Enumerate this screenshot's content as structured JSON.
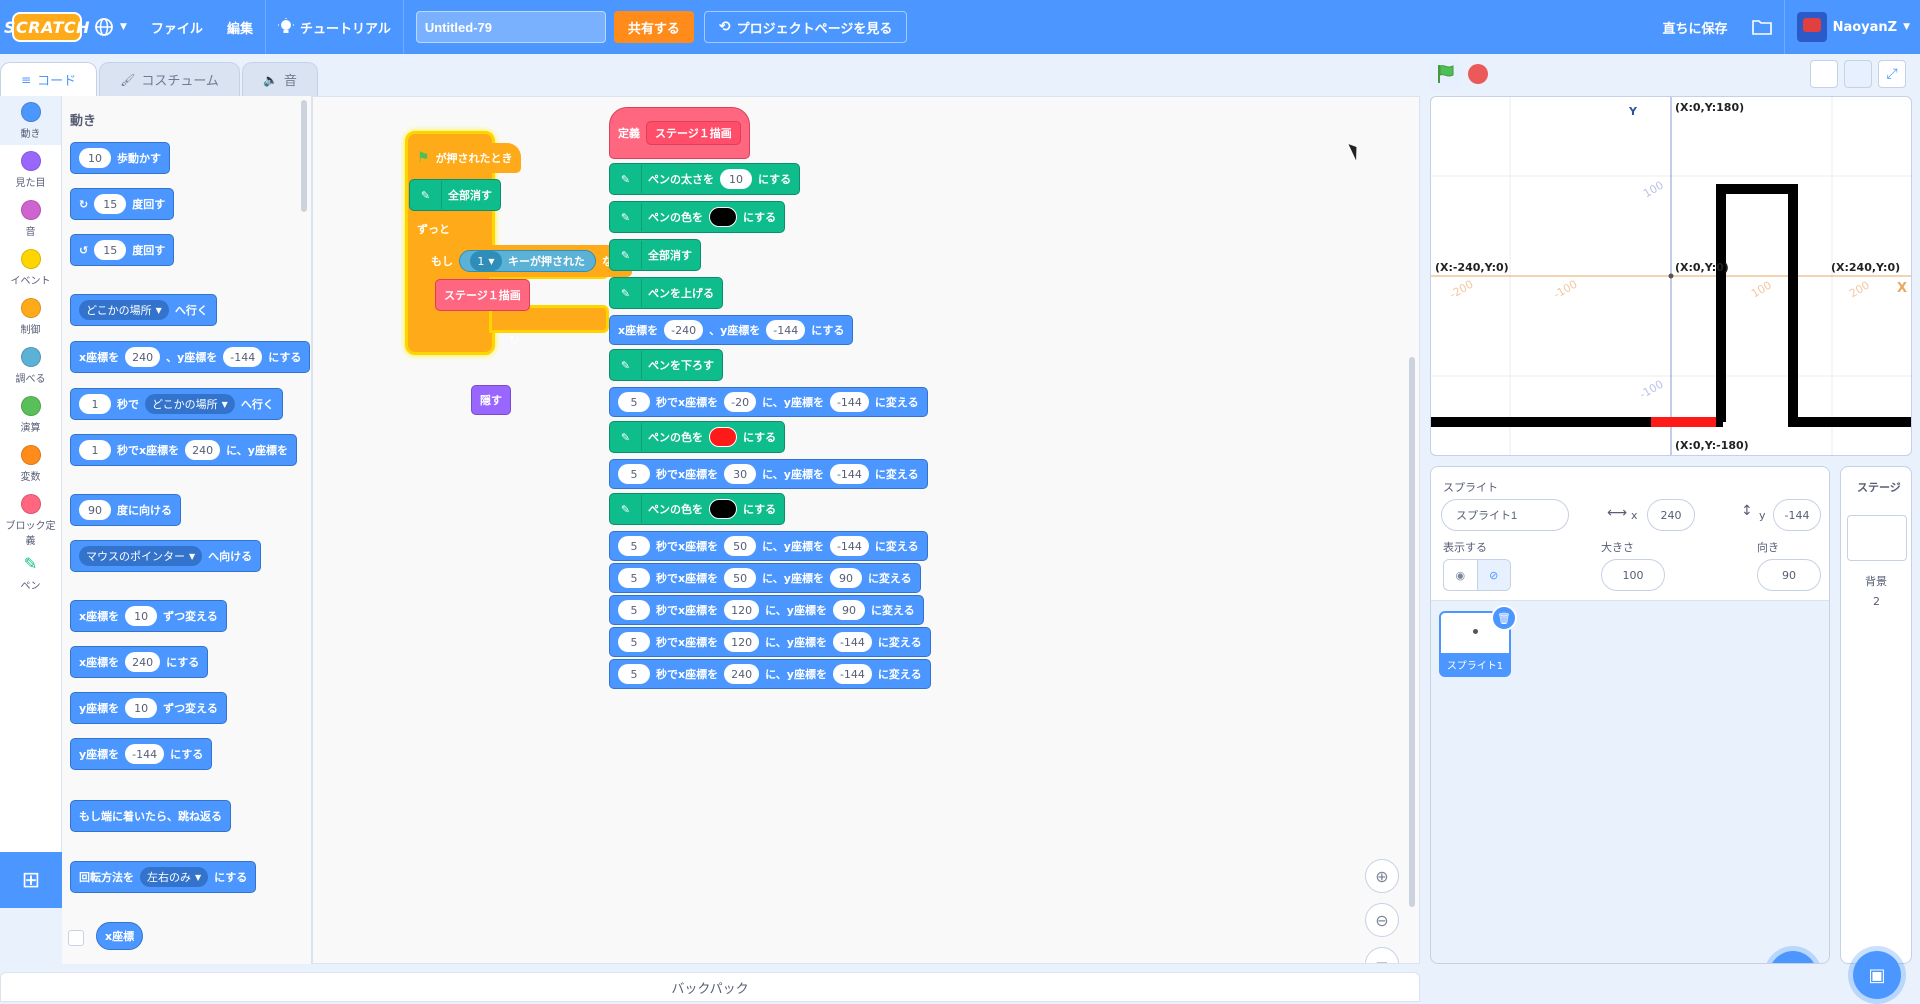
{
  "menubar": {
    "logo": "SCRATCH",
    "file": "ファイル",
    "edit": "編集",
    "tutorial": "チュートリアル",
    "project_title": "Untitled-79",
    "share": "共有する",
    "project_page": "プロジェクトページを見る",
    "save_now": "直ちに保存",
    "username": "NaoyanZ"
  },
  "tabs": {
    "code": "コード",
    "costume": "コスチューム",
    "sound": "音"
  },
  "categories": [
    {
      "label": "動き",
      "color": "#4c97ff"
    },
    {
      "label": "見た目",
      "color": "#9966ff"
    },
    {
      "label": "音",
      "color": "#cf63cf"
    },
    {
      "label": "イベント",
      "color": "#ffd500"
    },
    {
      "label": "制御",
      "color": "#ffab19"
    },
    {
      "label": "調べる",
      "color": "#5cb1d6"
    },
    {
      "label": "演算",
      "color": "#59c059"
    },
    {
      "label": "変数",
      "color": "#ff8c1a"
    },
    {
      "label": "ブロック定義",
      "color": "#ff6680"
    },
    {
      "label": "ペン",
      "color": "#0fbd8c"
    }
  ],
  "palette": {
    "title": "動き",
    "move": {
      "value": "10",
      "text": "歩動かす"
    },
    "turn_right": {
      "value": "15",
      "text": "度回す"
    },
    "turn_left": {
      "value": "15",
      "text": "度回す"
    },
    "goto": {
      "dropdown": "どこかの場所",
      "text": "へ行く"
    },
    "goto_xy": {
      "t1": "x座標を",
      "x": "240",
      "t2": "、y座標を",
      "y": "-144",
      "t3": "にする"
    },
    "glide_to": {
      "secs": "1",
      "t1": "秒で",
      "dropdown": "どこかの場所",
      "t2": "へ行く"
    },
    "glide_xy": {
      "secs": "1",
      "t1": "秒でx座標を",
      "x": "240",
      "t2": "に、y座標を"
    },
    "point_dir": {
      "value": "90",
      "text": "度に向ける"
    },
    "point_towards": {
      "dropdown": "マウスのポインター",
      "text": "へ向ける"
    },
    "change_x": {
      "t1": "x座標を",
      "value": "10",
      "t2": "ずつ変える"
    },
    "set_x": {
      "t1": "x座標を",
      "value": "240",
      "t2": "にする"
    },
    "change_y": {
      "t1": "y座標を",
      "value": "10",
      "t2": "ずつ変える"
    },
    "set_y": {
      "t1": "y座標を",
      "value": "-144",
      "t2": "にする"
    },
    "bounce": "もし端に着いたら、跳ね返る",
    "rotation": {
      "t1": "回転方法を",
      "dropdown": "左右のみ",
      "t2": "にする"
    },
    "x_pos": "x座標"
  },
  "script1": {
    "hat": "が押されたとき",
    "clear": "全部消す",
    "forever": "ずっと",
    "if": "もし",
    "key": "1",
    "key_pressed": "キーが押された",
    "then": "なら",
    "call": "ステージ１描画"
  },
  "hide_block": "隠す",
  "script2": {
    "define": "定義",
    "name": "ステージ１描画",
    "pen_size": {
      "t1": "ペンの太さを",
      "value": "10",
      "t2": "にする"
    },
    "pen_color_t1": "ペンの色を",
    "pen_color_t2": "にする",
    "clear": "全部消す",
    "pen_up": "ペンを上げる",
    "goto_xy": {
      "t1": "x座標を",
      "x": "-240",
      "t2": "、y座標を",
      "y": "-144",
      "t3": "にする"
    },
    "pen_down": "ペンを下ろす",
    "glide_t1": "秒でx座標を",
    "glide_t2": "に、y座標を",
    "glide_t3": "に変える",
    "glides": [
      {
        "secs": "5",
        "x": "-20",
        "y": "-144"
      },
      {
        "secs": "5",
        "x": "30",
        "y": "-144"
      },
      {
        "secs": "5",
        "x": "50",
        "y": "-144"
      },
      {
        "secs": "5",
        "x": "50",
        "y": "90"
      },
      {
        "secs": "5",
        "x": "120",
        "y": "90"
      },
      {
        "secs": "5",
        "x": "120",
        "y": "-144"
      },
      {
        "secs": "5",
        "x": "240",
        "y": "-144"
      }
    ],
    "colors": {
      "black": "#000000",
      "red": "#ff1a1a"
    }
  },
  "stage": {
    "top": "(X:0,Y:180)",
    "bottom": "(X:0,Y:-180)",
    "left": "(X:-240,Y:0)",
    "center": "(X:0,Y:0)",
    "right": "(X:240,Y:0)",
    "x_axis": "X",
    "y_axis": "Y",
    "ticks": {
      "m200": "-200",
      "m100": "-100",
      "p100": "100",
      "p200": "200",
      "y100": "100",
      "ym100": "-100"
    }
  },
  "sprite_info": {
    "sprite_label": "スプライト",
    "name": "スプライト1",
    "x_label": "x",
    "x": "240",
    "y_label": "y",
    "y": "-144",
    "show_label": "表示する",
    "size_label": "大きさ",
    "size": "100",
    "dir_label": "向き",
    "direction": "90",
    "tile_name": "スプライト1"
  },
  "stage_pane": {
    "title": "ステージ",
    "backdrop_label": "背景",
    "backdrop_count": "2"
  },
  "backpack": "バックパック"
}
